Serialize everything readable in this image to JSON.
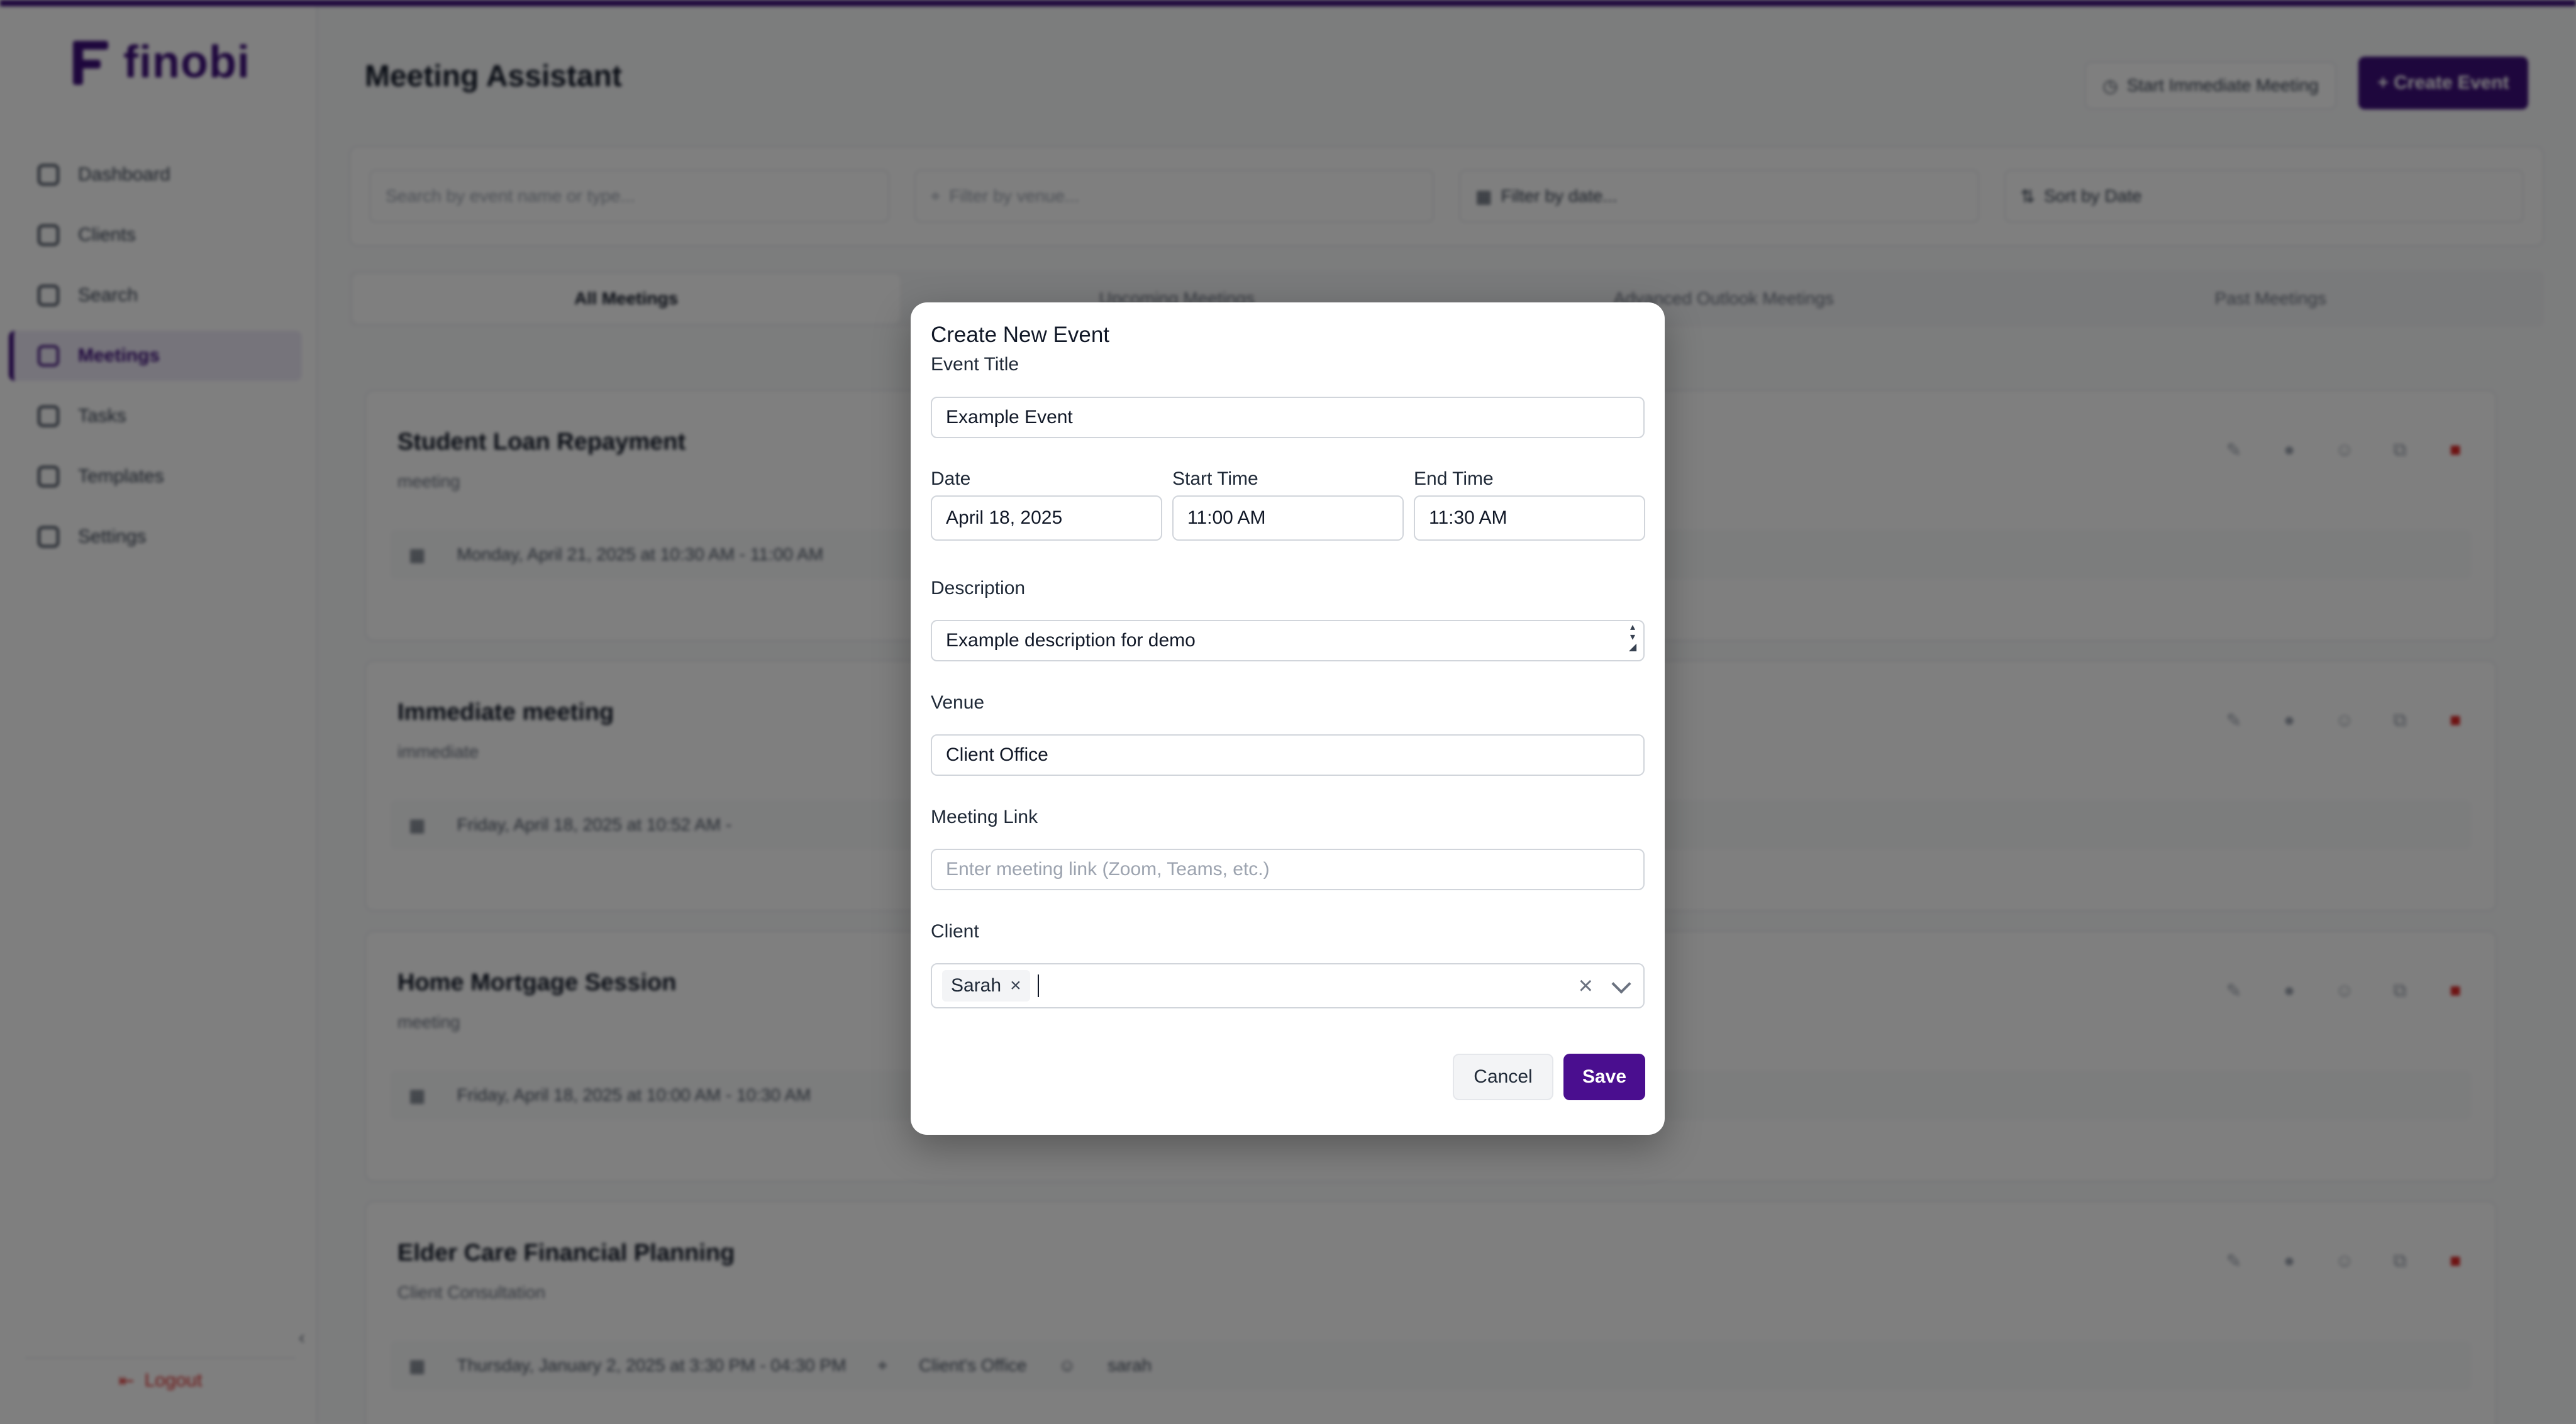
{
  "brand": {
    "name": "finobi",
    "accent": "#3d0e7a"
  },
  "sidebar": {
    "items": [
      {
        "label": "Dashboard",
        "icon": "home-icon"
      },
      {
        "label": "Clients",
        "icon": "users-icon"
      },
      {
        "label": "Search",
        "icon": "search-icon"
      },
      {
        "label": "Meetings",
        "icon": "calendar-icon",
        "active": true
      },
      {
        "label": "Tasks",
        "icon": "checklist-icon"
      },
      {
        "label": "Templates",
        "icon": "template-icon"
      },
      {
        "label": "Settings",
        "icon": "gear-icon"
      }
    ],
    "logout_label": "Logout"
  },
  "header": {
    "title": "Meeting Assistant",
    "immediate_label": "Start Immediate Meeting",
    "create_label": "+ Create Event"
  },
  "filters": {
    "search_placeholder": "Search by event name or type...",
    "venue_placeholder": "Filter by venue...",
    "date_label": "Filter by date...",
    "sort_label": "Sort by Date"
  },
  "tabs": [
    "All Meetings",
    "Upcoming Meetings",
    "Advanced Outlook Meetings",
    "Past Meetings"
  ],
  "meetings": [
    {
      "title": "Student Loan Repayment",
      "type": "meeting",
      "when": "Monday, April 21, 2025 at 10:30 AM - 11:00 AM",
      "extra": ""
    },
    {
      "title": "Immediate meeting",
      "type": "immediate",
      "when": "Friday, April 18, 2025 at 10:52 AM -",
      "extra": ""
    },
    {
      "title": "Home Mortgage Session",
      "type": "meeting",
      "when": "Friday, April 18, 2025 at 10:00 AM - 10:30 AM",
      "extra": ""
    },
    {
      "title": "Elder Care Financial Planning",
      "type": "Client Consultation",
      "when": "Thursday, January 2, 2025 at 3:30 PM - 04:30 PM",
      "extra": "Client's Office",
      "person": "sarah"
    }
  ],
  "modal": {
    "title": "Create New Event",
    "event_title_label": "Event Title",
    "event_title_value": "Example Event",
    "date_label": "Date",
    "date_value": "April 18, 2025",
    "start_label": "Start Time",
    "start_value": "11:00 AM",
    "end_label": "End Time",
    "end_value": "11:30 AM",
    "description_label": "Description",
    "description_value": "Example description for demo",
    "venue_label": "Venue",
    "venue_value": "Client Office",
    "link_label": "Meeting Link",
    "link_placeholder": "Enter meeting link (Zoom, Teams, etc.)",
    "client_label": "Client",
    "client_chip": "Sarah",
    "cancel_label": "Cancel",
    "save_label": "Save"
  }
}
